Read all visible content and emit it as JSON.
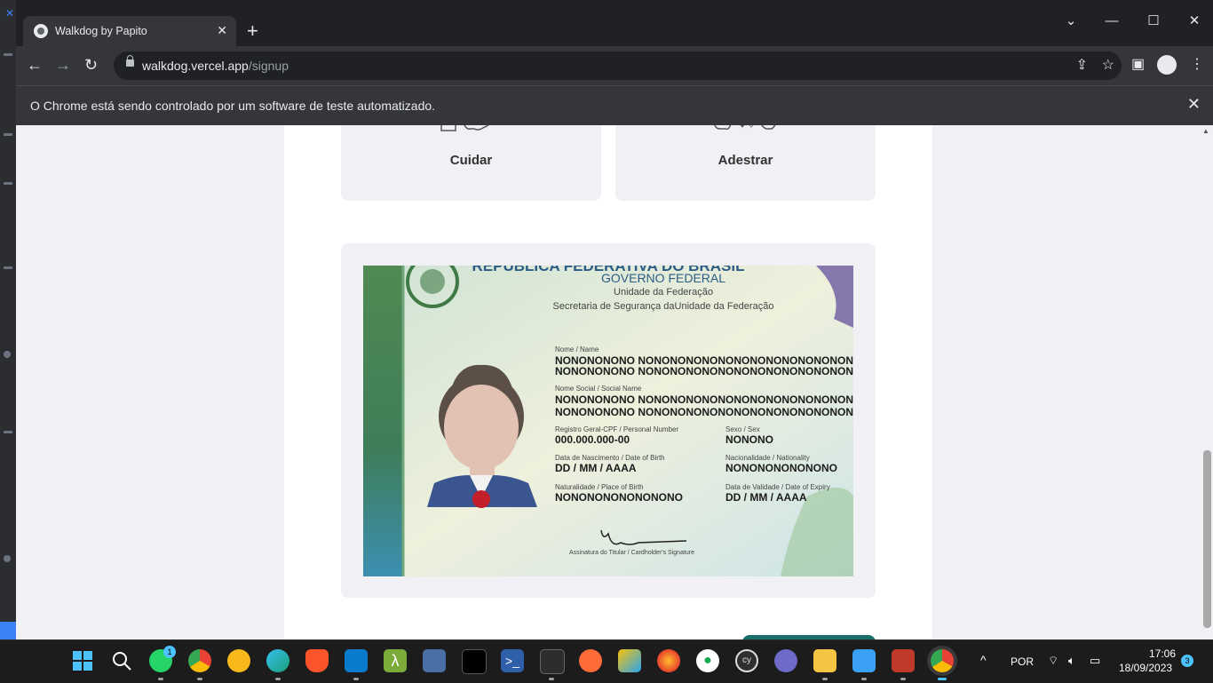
{
  "browser": {
    "tab_title": "Walkdog by Papito",
    "url_host": "walkdog.vercel.app",
    "url_path": "/signup",
    "infobar_text": "O Chrome está sendo controlado por um software de teste automatizado."
  },
  "page": {
    "service_cards": [
      {
        "label": "Cuidar"
      },
      {
        "label": "Adestrar"
      }
    ],
    "id_card": {
      "republic": "REPÚBLICA FEDERATIVA DO BRASIL",
      "government": "GOVERNO FEDERAL",
      "unit": "Unidade da Federação",
      "secretariat": "Secretaria de Segurança daUnidade da Federação",
      "name_label": "Nome / Name",
      "name_value_1": "NONONONONO NONONONONONONONONONONONONONONO",
      "name_value_2": "NONONONONO NONONONONONONONONONONONONONONO",
      "social_name_label": "Nome Social / Social Name",
      "social_name_value_1": "NONONONONO NONONONONONONONONONONONONONONO",
      "social_name_value_2": "NONONONONO NONONONONONONONONONONONONONONO",
      "cpf_label": "Registro Geral-CPF / Personal Number",
      "cpf_value": "000.000.000-00",
      "sex_label": "Sexo / Sex",
      "sex_value": "NONONO",
      "birth_label": "Data de Nascimento / Date of Birth",
      "birth_value": "DD / MM / AAAA",
      "nationality_label": "Nacionalidade / Nationality",
      "nationality_value": "NONONONONONONO",
      "birthplace_label": "Naturalidade / Place of Birth",
      "birthplace_value": "NONONONONONONONO",
      "validity_label": "Data de Validade / Date of Expiry",
      "validity_value": "DD / MM / AAAA",
      "signature_label": "Assinatura do Titular / Cardholder's Signature"
    }
  },
  "taskbar": {
    "whatsapp_badge": "1",
    "language": "POR",
    "time": "17:06",
    "date": "18/09/2023",
    "notification_count": "3"
  },
  "colors": {
    "accent_button": "#1b6f6a",
    "page_bg": "#f0f0f5"
  }
}
